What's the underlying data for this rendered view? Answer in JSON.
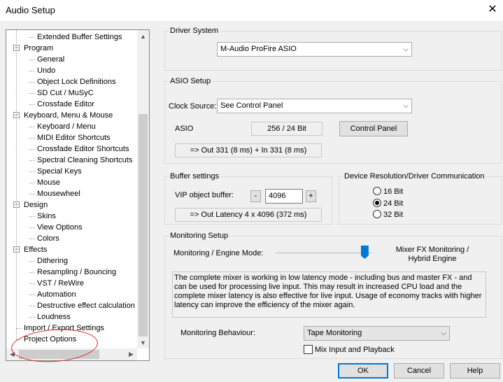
{
  "window": {
    "title": "Audio Setup",
    "close_glyph": "✕"
  },
  "tree": {
    "items": [
      {
        "label": "Extended Buffer Settings",
        "level": 1
      },
      {
        "label": "Program",
        "level": 0,
        "expander": "−"
      },
      {
        "label": "General",
        "level": 1
      },
      {
        "label": "Undo",
        "level": 1
      },
      {
        "label": "Object Lock Definitions",
        "level": 1
      },
      {
        "label": "SD Cut / MuSyC",
        "level": 1
      },
      {
        "label": "Crossfade Editor",
        "level": 1
      },
      {
        "label": "Keyboard, Menu & Mouse",
        "level": 0,
        "expander": "−"
      },
      {
        "label": "Keyboard / Menu",
        "level": 1
      },
      {
        "label": "MIDI Editor Shortcuts",
        "level": 1
      },
      {
        "label": "Crossfade Editor Shortcuts",
        "level": 1
      },
      {
        "label": "Spectral Cleaning Shortcuts",
        "level": 1
      },
      {
        "label": "Special Keys",
        "level": 1
      },
      {
        "label": "Mouse",
        "level": 1
      },
      {
        "label": "Mousewheel",
        "level": 1
      },
      {
        "label": "Design",
        "level": 0,
        "expander": "−"
      },
      {
        "label": "Skins",
        "level": 1
      },
      {
        "label": "View Options",
        "level": 1
      },
      {
        "label": "Colors",
        "level": 1
      },
      {
        "label": "Effects",
        "level": 0,
        "expander": "−"
      },
      {
        "label": "Dithering",
        "level": 1
      },
      {
        "label": "Resampling / Bouncing",
        "level": 1
      },
      {
        "label": "VST / ReWire",
        "level": 1
      },
      {
        "label": "Automation",
        "level": 1
      },
      {
        "label": "Destructive effect calculation",
        "level": 1
      },
      {
        "label": "Loudness",
        "level": 1
      },
      {
        "label": "Import / Export Settings",
        "level": 0
      },
      {
        "label": "Project Options",
        "level": 0
      }
    ],
    "scroll_up": "▲",
    "scroll_down": "▼",
    "scroll_left": "◀",
    "scroll_right": "▶"
  },
  "driver_system": {
    "label": "Driver System",
    "selected": "M-Audio ProFire ASIO",
    "chevron": "⌵"
  },
  "asio_setup": {
    "label": "ASIO Setup",
    "clock_source_label": "Clock Source:",
    "clock_source_value": "See Control Panel",
    "asio_label": "ASIO",
    "asio_value": "256 / 24 Bit",
    "control_panel_button": "Control Panel",
    "latency": "=> Out 331 (8 ms) + In 331 (8 ms)"
  },
  "buffer_settings": {
    "label": "Buffer settings",
    "vip_label": "VIP object buffer:",
    "minus": "-",
    "value": "4096",
    "plus": "+",
    "out_latency": "=> Out Latency 4 x 4096 (372 ms)"
  },
  "device_resolution": {
    "label": "Device Resolution/Driver Communication",
    "options": [
      "16 Bit",
      "24 Bit",
      "32 Bit"
    ],
    "selected": "24 Bit"
  },
  "monitoring": {
    "label": "Monitoring Setup",
    "engine_mode_label": "Monitoring / Engine Mode:",
    "engine_mode_value_line1": "Mixer FX Monitoring /",
    "engine_mode_value_line2": "Hybrid Engine",
    "slider_level": 0.94,
    "description": "The complete mixer is working in low latency mode - including bus and master FX - and can be used for processing live input.  This may result in increased CPU load and the complete mixer latency is also effective for live input. Usage of economy tracks with higher latency can improve the efficiency of the mixer again.",
    "behaviour_label": "Monitoring Behaviour:",
    "behaviour_value": "Tape Monitoring",
    "mix_input_label": "Mix Input and Playback",
    "mix_input_checked": false
  },
  "footer": {
    "ok": "OK",
    "cancel": "Cancel",
    "help": "Help"
  },
  "colors": {
    "accent": "#0078d7",
    "annotation": "#e02020"
  }
}
